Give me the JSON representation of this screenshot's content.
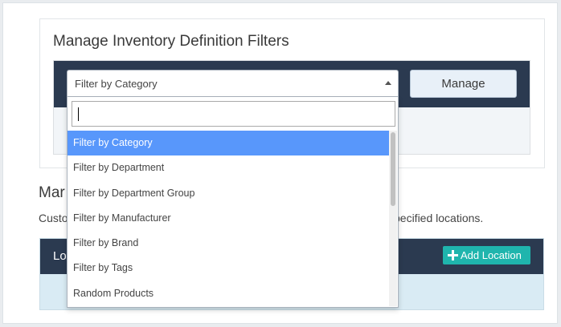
{
  "filters_card": {
    "title": "Manage Inventory Definition Filters",
    "selected_filter": "Filter by Category",
    "manage_label": "Manage"
  },
  "dropdown": {
    "search_value": "",
    "options": [
      "Filter by Category",
      "Filter by Department",
      "Filter by Department Group",
      "Filter by Manufacturer",
      "Filter by Brand",
      "Filter by Tags",
      "Random Products"
    ],
    "active_index": 0
  },
  "locations_section": {
    "title_partial": "Mar",
    "desc_left_partial": "Custo",
    "desc_right_partial": "pecified locations.",
    "panel_header_partial": "Lo",
    "add_location_label": "Add Location"
  },
  "colors": {
    "panel_header": "#2b3a50",
    "active_option": "#5897fb",
    "add_button": "#1fb5ad",
    "location_panel_body": "#d9ebf4"
  }
}
